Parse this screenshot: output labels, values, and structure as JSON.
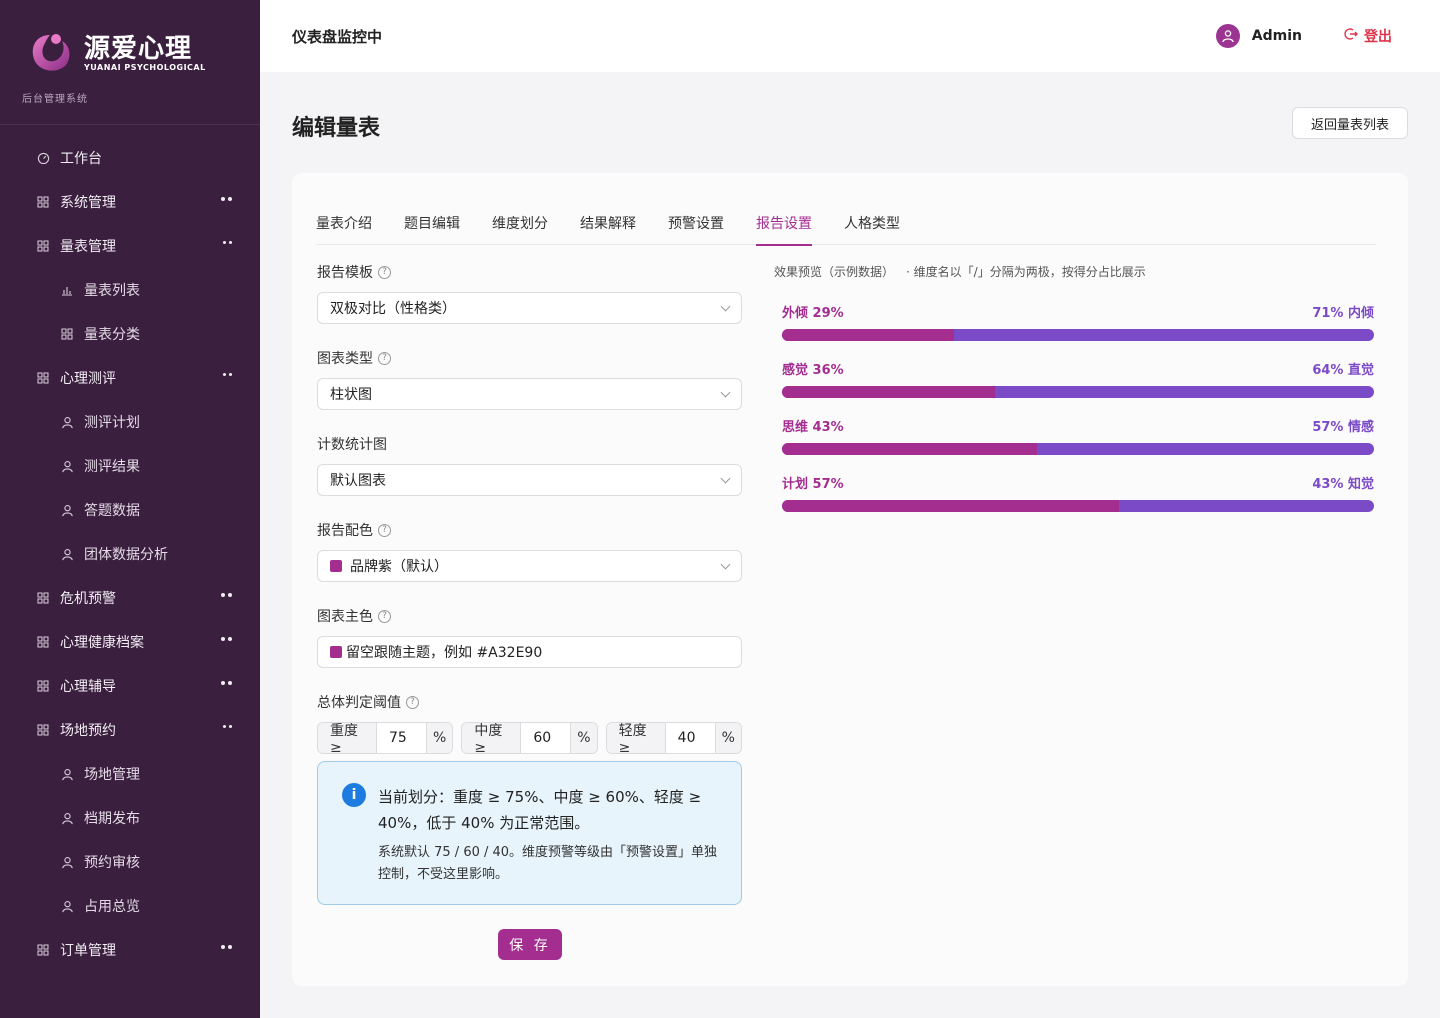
{
  "sidebar": {
    "brand_name": "源爱心理",
    "brand_sub": "YUANAI PSYCHOLOGICAL",
    "system_label": "后台管理系统",
    "items": [
      {
        "label": "工作台",
        "icon": "dashboard-icon",
        "type": "top"
      },
      {
        "label": "系统管理",
        "icon": "grid-icon",
        "type": "top",
        "arrow": "collapsed"
      },
      {
        "label": "量表管理",
        "icon": "grid-icon",
        "type": "top",
        "arrow": "expanded"
      },
      {
        "label": "量表列表",
        "icon": "bar-chart-icon",
        "type": "sub"
      },
      {
        "label": "量表分类",
        "icon": "grid-icon",
        "type": "sub"
      },
      {
        "label": "心理测评",
        "icon": "grid-icon",
        "type": "top",
        "arrow": "expanded"
      },
      {
        "label": "测评计划",
        "icon": "user-icon",
        "type": "sub"
      },
      {
        "label": "测评结果",
        "icon": "user-icon",
        "type": "sub"
      },
      {
        "label": "答题数据",
        "icon": "user-icon",
        "type": "sub"
      },
      {
        "label": "团体数据分析",
        "icon": "user-icon",
        "type": "sub"
      },
      {
        "label": "危机预警",
        "icon": "grid-icon",
        "type": "top",
        "arrow": "collapsed"
      },
      {
        "label": "心理健康档案",
        "icon": "grid-icon",
        "type": "top",
        "arrow": "collapsed"
      },
      {
        "label": "心理辅导",
        "icon": "grid-icon",
        "type": "top",
        "arrow": "collapsed"
      },
      {
        "label": "场地预约",
        "icon": "grid-icon",
        "type": "top",
        "arrow": "expanded"
      },
      {
        "label": "场地管理",
        "icon": "user-icon",
        "type": "sub"
      },
      {
        "label": "档期发布",
        "icon": "user-icon",
        "type": "sub"
      },
      {
        "label": "预约审核",
        "icon": "user-icon",
        "type": "sub"
      },
      {
        "label": "占用总览",
        "icon": "user-icon",
        "type": "sub"
      },
      {
        "label": "订单管理",
        "icon": "grid-icon",
        "type": "top",
        "arrow": "collapsed"
      }
    ]
  },
  "topbar": {
    "title": "仪表盘监控中",
    "user_name": "Admin",
    "logout_label": "登出"
  },
  "page": {
    "title": "编辑量表",
    "back_label": "返回量表列表"
  },
  "tabs": [
    "量表介绍",
    "题目编辑",
    "维度划分",
    "结果解释",
    "预警设置",
    "报告设置",
    "人格类型"
  ],
  "active_tab": "报告设置",
  "form": {
    "report_template": {
      "label": "报告模板",
      "value": "双极对比（性格类）"
    },
    "chart_type": {
      "label": "图表类型",
      "value": "柱状图"
    },
    "count_chart": {
      "label": "计数统计图",
      "value": "默认图表"
    },
    "report_color": {
      "label": "报告配色",
      "value": "品牌紫（默认）"
    },
    "chart_main_color": {
      "label": "图表主色",
      "placeholder": "留空跟随主题，例如 #A32E90"
    },
    "threshold": {
      "label": "总体判定阈值",
      "groups": [
        {
          "label": "重度 ≥",
          "value": "75",
          "unit": "%"
        },
        {
          "label": "中度 ≥",
          "value": "60",
          "unit": "%"
        },
        {
          "label": "轻度 ≥",
          "value": "40",
          "unit": "%"
        }
      ]
    },
    "info_main": "当前划分：重度 ≥ 75%、中度 ≥ 60%、轻度 ≥ 40%，低于 40% 为正常范围。",
    "info_sub": "系统默认 75 / 60 / 40。维度预警等级由「预警设置」单独控制，不受这里影响。",
    "save_label": "保 存"
  },
  "preview": {
    "title": "效果预览（示例数据）",
    "note": "· 维度名以「/」分隔为两极，按得分占比展示",
    "rows": [
      {
        "left": "外倾 29%",
        "right": "71% 内倾",
        "fraction": 0.29
      },
      {
        "left": "感觉 36%",
        "right": "64% 直觉",
        "fraction": 0.36
      },
      {
        "left": "思维 43%",
        "right": "57% 情感",
        "fraction": 0.43
      },
      {
        "left": "计划 57%",
        "right": "43% 知觉",
        "fraction": 0.57
      }
    ]
  },
  "colors": {
    "brand": "#a32e90",
    "secondary": "#7b4ac6",
    "sidebar_bg": "#3b1f3f",
    "logout": "#e0344a"
  }
}
